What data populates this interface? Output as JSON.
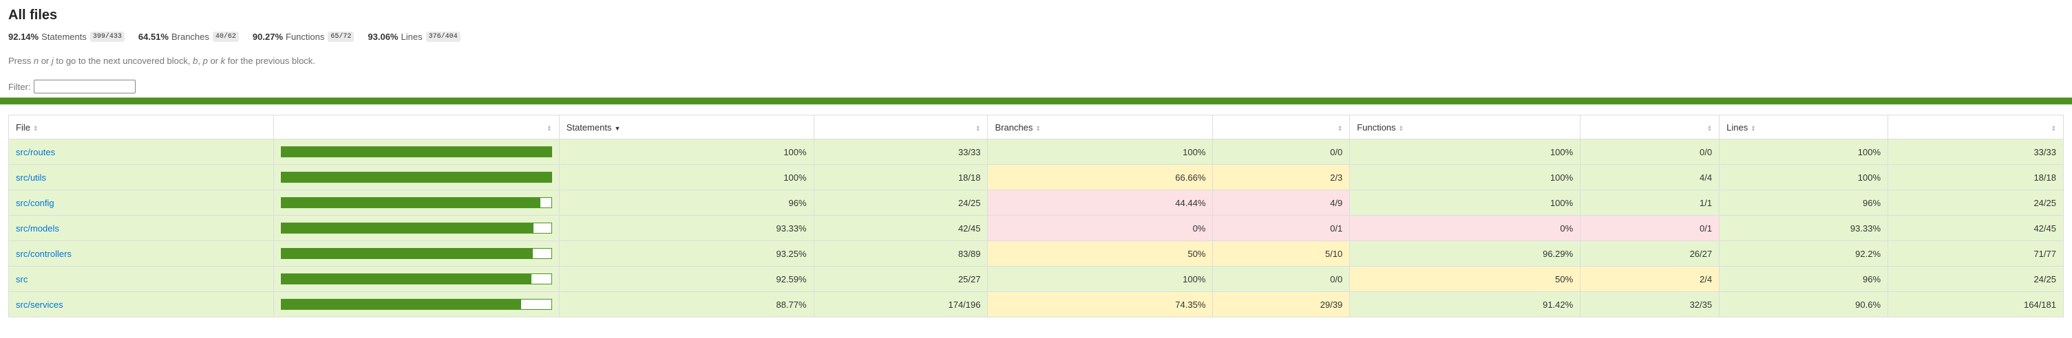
{
  "page": {
    "title": "All files",
    "help_parts": [
      "Press ",
      "n",
      " or ",
      "j",
      " to go to the next uncovered block, ",
      "b",
      ", ",
      "p",
      " or ",
      "k",
      " for the previous block."
    ],
    "filter_label": "Filter:",
    "filter_value": ""
  },
  "summary": [
    {
      "pct": "92.14%",
      "label": "Statements",
      "fraction": "399/433"
    },
    {
      "pct": "64.51%",
      "label": "Branches",
      "fraction": "40/62"
    },
    {
      "pct": "90.27%",
      "label": "Functions",
      "fraction": "65/72"
    },
    {
      "pct": "93.06%",
      "label": "Lines",
      "fraction": "376/404"
    }
  ],
  "colors": {
    "high": "#e6f5d0",
    "medium": "#fff4c2",
    "low": "#fce1e5",
    "bar": "#4d9221",
    "link": "#0074d9"
  },
  "table": {
    "headers": {
      "file": "File",
      "statements": "Statements",
      "branches": "Branches",
      "functions": "Functions",
      "lines": "Lines"
    },
    "rows": [
      {
        "file": "src/routes",
        "bar": 1.0,
        "stmt_pct": "100%",
        "stmt_frac": "33/33",
        "stmt_level": "high",
        "br_pct": "100%",
        "br_frac": "0/0",
        "br_level": "high",
        "fn_pct": "100%",
        "fn_frac": "0/0",
        "fn_level": "high",
        "ln_pct": "100%",
        "ln_frac": "33/33",
        "ln_level": "high"
      },
      {
        "file": "src/utils",
        "bar": 1.0,
        "stmt_pct": "100%",
        "stmt_frac": "18/18",
        "stmt_level": "high",
        "br_pct": "66.66%",
        "br_frac": "2/3",
        "br_level": "medium",
        "fn_pct": "100%",
        "fn_frac": "4/4",
        "fn_level": "high",
        "ln_pct": "100%",
        "ln_frac": "18/18",
        "ln_level": "high"
      },
      {
        "file": "src/config",
        "bar": 0.96,
        "stmt_pct": "96%",
        "stmt_frac": "24/25",
        "stmt_level": "high",
        "br_pct": "44.44%",
        "br_frac": "4/9",
        "br_level": "low",
        "fn_pct": "100%",
        "fn_frac": "1/1",
        "fn_level": "high",
        "ln_pct": "96%",
        "ln_frac": "24/25",
        "ln_level": "high"
      },
      {
        "file": "src/models",
        "bar": 0.9333,
        "stmt_pct": "93.33%",
        "stmt_frac": "42/45",
        "stmt_level": "high",
        "br_pct": "0%",
        "br_frac": "0/1",
        "br_level": "low",
        "fn_pct": "0%",
        "fn_frac": "0/1",
        "fn_level": "low",
        "ln_pct": "93.33%",
        "ln_frac": "42/45",
        "ln_level": "high"
      },
      {
        "file": "src/controllers",
        "bar": 0.9325,
        "stmt_pct": "93.25%",
        "stmt_frac": "83/89",
        "stmt_level": "high",
        "br_pct": "50%",
        "br_frac": "5/10",
        "br_level": "medium",
        "fn_pct": "96.29%",
        "fn_frac": "26/27",
        "fn_level": "high",
        "ln_pct": "92.2%",
        "ln_frac": "71/77",
        "ln_level": "high"
      },
      {
        "file": "src",
        "bar": 0.9259,
        "stmt_pct": "92.59%",
        "stmt_frac": "25/27",
        "stmt_level": "high",
        "br_pct": "100%",
        "br_frac": "0/0",
        "br_level": "high",
        "fn_pct": "50%",
        "fn_frac": "2/4",
        "fn_level": "medium",
        "ln_pct": "96%",
        "ln_frac": "24/25",
        "ln_level": "high"
      },
      {
        "file": "src/services",
        "bar": 0.8877,
        "stmt_pct": "88.77%",
        "stmt_frac": "174/196",
        "stmt_level": "high",
        "br_pct": "74.35%",
        "br_frac": "29/39",
        "br_level": "medium",
        "fn_pct": "91.42%",
        "fn_frac": "32/35",
        "fn_level": "high",
        "ln_pct": "90.6%",
        "ln_frac": "164/181",
        "ln_level": "high"
      }
    ]
  }
}
